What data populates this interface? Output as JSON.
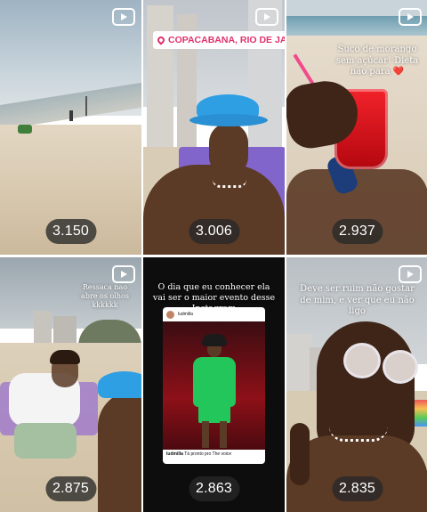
{
  "grid": {
    "tiles": [
      {
        "id": "t1",
        "view_count": "3.150"
      },
      {
        "id": "t2",
        "view_count": "3.006",
        "location_sticker": "COPACABANA, RIO DE JANEIRO"
      },
      {
        "id": "t3",
        "view_count": "2.937",
        "caption": "Suco de morango sem açúcar! Dieta não para",
        "caption_emoji": "❤️"
      },
      {
        "id": "t4",
        "view_count": "2.875",
        "caption": "Ressaca nao abre os olhos kkkkkk"
      },
      {
        "id": "t5",
        "view_count": "2.863",
        "caption": "O dia que eu conhecer ela vai ser o maior evento desse Instagram",
        "inner_post": {
          "username": "ludmilla",
          "comment_user": "ludmilla",
          "comment_text": "Tá pronto pro The voice"
        }
      },
      {
        "id": "t6",
        "view_count": "2.835",
        "caption": "Deve ser ruim não gostar de mim, e ver que eu não ligo"
      }
    ],
    "icon": "reels-icon"
  },
  "colors": {
    "pill_bg": "#282828",
    "sticker_text": "#e1306c",
    "story_bg": "#0d0d0d"
  }
}
